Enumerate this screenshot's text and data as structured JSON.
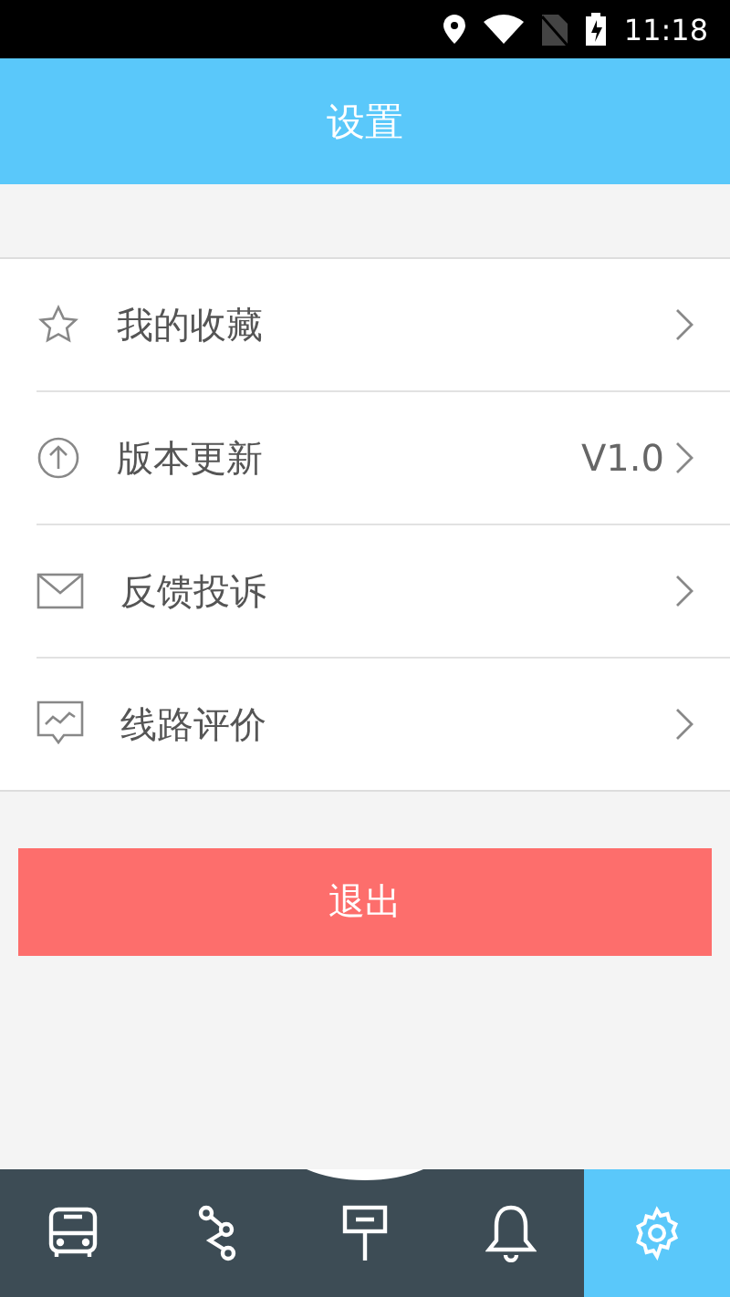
{
  "status_bar": {
    "time": "11:18"
  },
  "header": {
    "title": "设置"
  },
  "menu": [
    {
      "label": "我的收藏"
    },
    {
      "label": "版本更新",
      "value": "V1.0"
    },
    {
      "label": "反馈投诉"
    },
    {
      "label": "线路评价"
    }
  ],
  "logout_button": "退出",
  "bottom_nav": [
    {
      "selected": false
    },
    {
      "selected": false
    },
    {
      "selected": false
    },
    {
      "selected": false
    },
    {
      "selected": true
    }
  ]
}
